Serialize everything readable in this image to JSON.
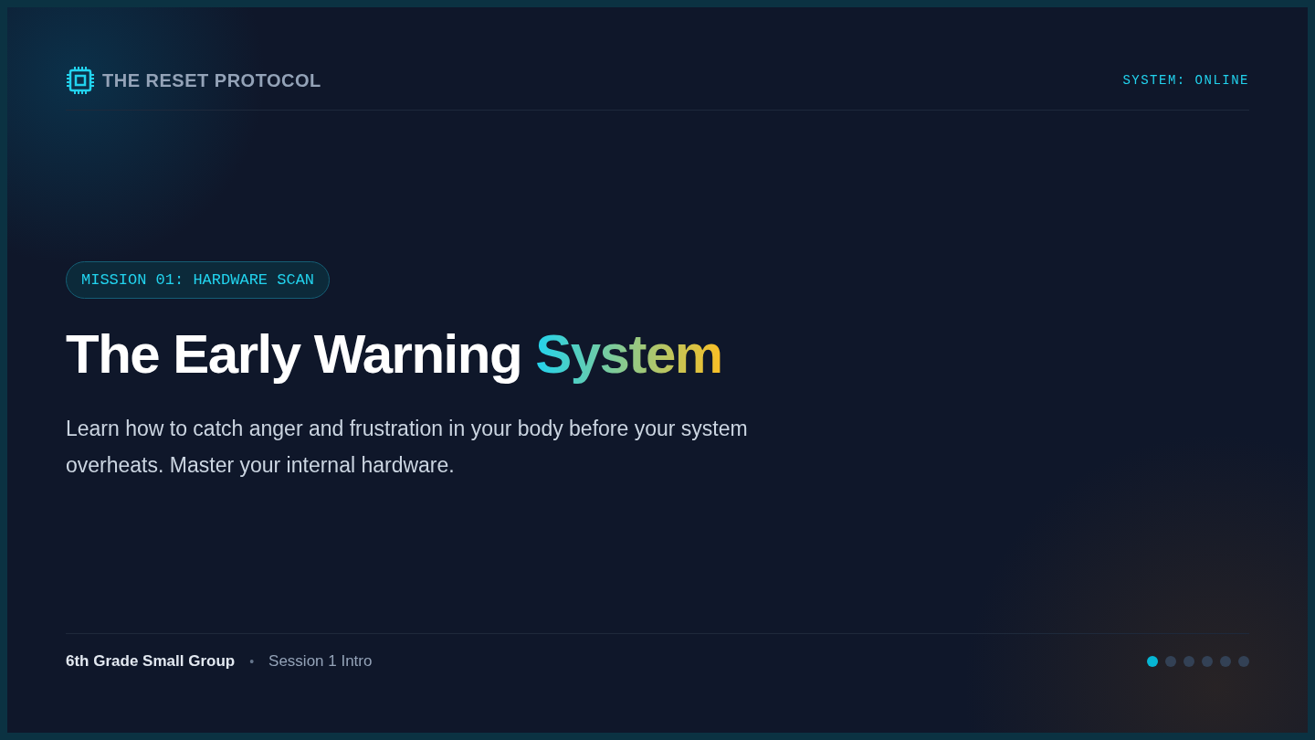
{
  "header": {
    "brand": "THE RESET PROTOCOL",
    "status": "SYSTEM: ONLINE"
  },
  "hero": {
    "badge": "MISSION 01: HARDWARE SCAN",
    "title": "The Early Warning",
    "title_highlight": "System",
    "subtitle": "Learn how to catch anger and frustration in your body before your system overheats. Master your internal hardware."
  },
  "footer": {
    "group": "6th Grade Small Group",
    "separator": "•",
    "session": "Session 1 Intro"
  },
  "slides": [
    {
      "selected": true
    },
    {
      "selected": false
    },
    {
      "selected": false
    },
    {
      "selected": false
    },
    {
      "selected": false
    },
    {
      "selected": false
    }
  ]
}
